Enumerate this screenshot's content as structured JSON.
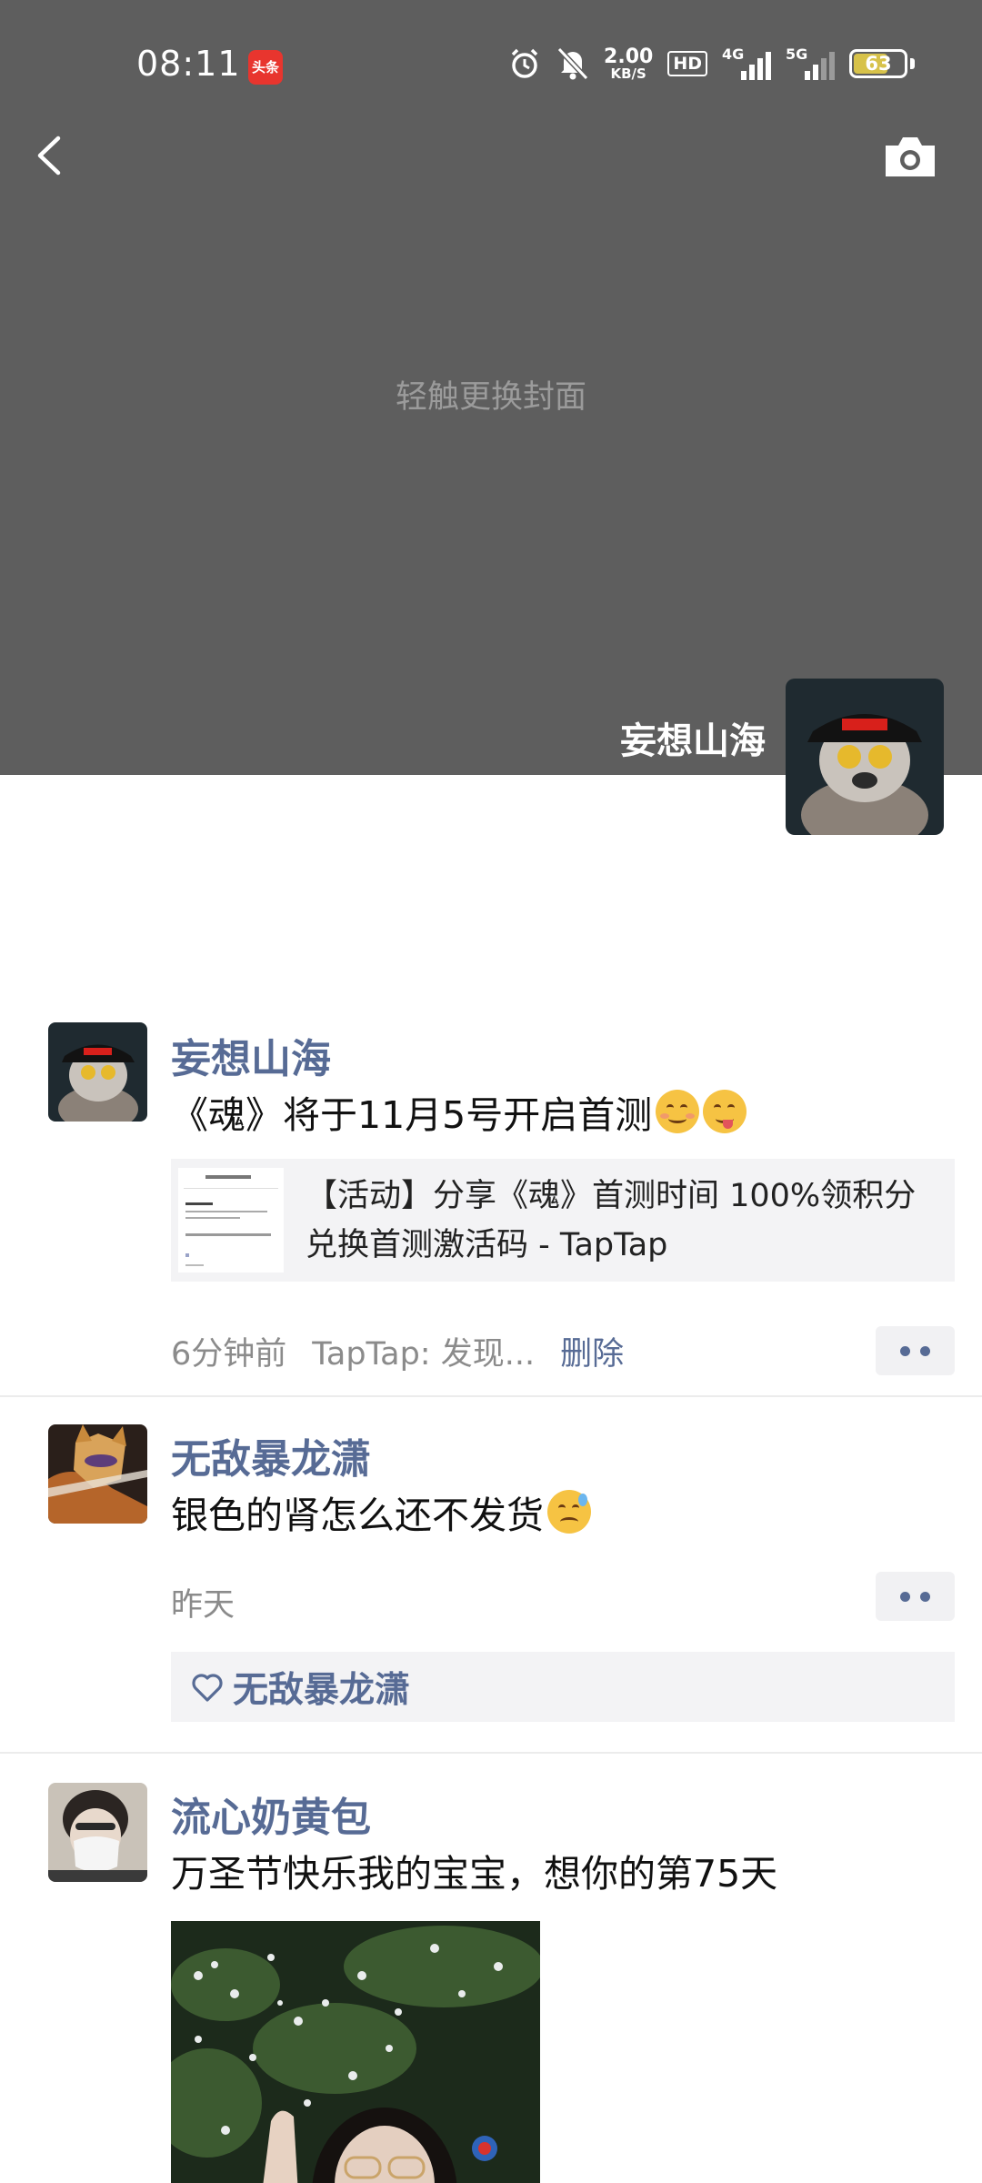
{
  "status_bar": {
    "time": "08:11",
    "app_badge": "头条",
    "net_speed_value": "2.00",
    "net_speed_unit": "KB/S",
    "hd_label": "HD",
    "sim1_label": "4G",
    "sim2_label": "5G",
    "battery_percent": "63",
    "battery_level": 0.63,
    "icons": [
      "alarm-icon",
      "mute-icon",
      "network-speed",
      "hd-icon",
      "signal-4g-icon",
      "signal-5g-icon",
      "battery-icon"
    ]
  },
  "header": {
    "back_icon": "chevron-left-icon",
    "camera_icon": "camera-icon",
    "cover_hint": "轻触更换封面",
    "profile_name": "妄想山海"
  },
  "posts": [
    {
      "author": "妄想山海",
      "text": "《魂》将于11月5号开启首测",
      "emojis": [
        "smile",
        "yum"
      ],
      "link": {
        "title": "【活动】分享《魂》首测时间 100%领积分兑换首测激活码 - TapTap"
      },
      "time": "6分钟前",
      "source": "TapTap: 发现...",
      "delete_label": "删除"
    },
    {
      "author": "无敌暴龙潇",
      "text": "银色的肾怎么还不发货",
      "emojis": [
        "sweat"
      ],
      "time": "昨天",
      "likes": [
        "无敌暴龙潇"
      ]
    },
    {
      "author": "流心奶黄包",
      "text": "万圣节快乐我的宝宝，想你的第75天"
    }
  ],
  "colors": {
    "cover_bg": "#5e5e5e",
    "link_blue": "#576b95",
    "card_bg": "#f3f3f5",
    "meta_gray": "#8b8b8b"
  }
}
